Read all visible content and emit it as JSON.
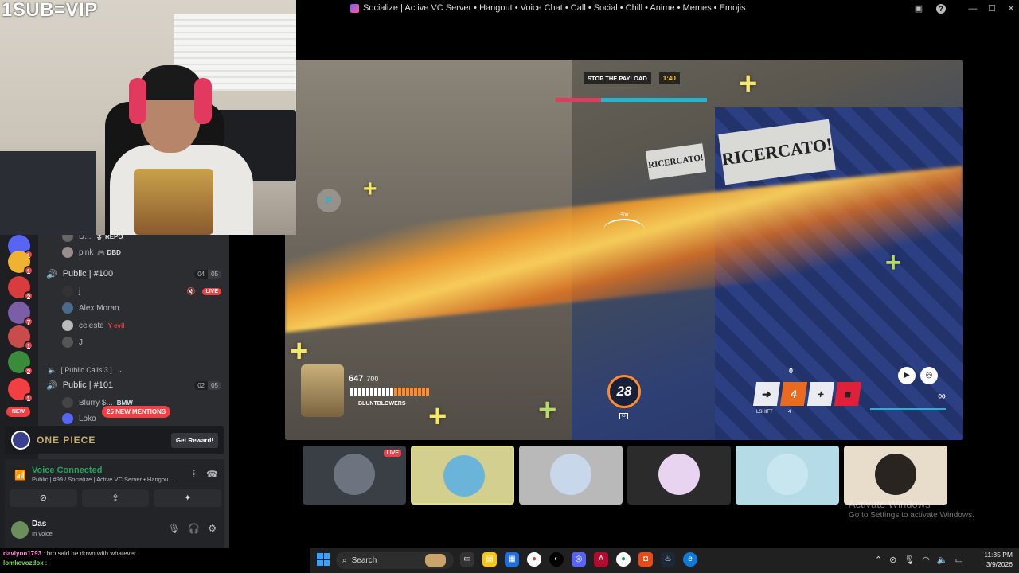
{
  "overlay": {
    "text": "1SUB=VIP"
  },
  "window": {
    "title": "Socialize | Active VC Server • Hangout • Voice Chat • Call • Social • Chill • Anime • Memes • Emojis"
  },
  "guilds": [
    {
      "name": "server-1",
      "badge": "1",
      "color": "#5865f2"
    },
    {
      "name": "discord-yellow",
      "badge": "1",
      "color": "#f0b232"
    },
    {
      "name": "server-3",
      "badge": "2",
      "color": "#d83c3e"
    },
    {
      "name": "server-4",
      "badge": "7",
      "color": "#7b5ea7"
    },
    {
      "name": "server-5",
      "badge": "1",
      "color": "#c94c4c"
    },
    {
      "name": "server-6",
      "badge": "2",
      "color": "#3a8c3a"
    },
    {
      "name": "discord-red",
      "badge": "1",
      "color": "#f23f43"
    }
  ],
  "new_label": "NEW",
  "channels": {
    "users_top": [
      {
        "name": "D...",
        "tag": "🎖 REPO"
      },
      {
        "name": "pink",
        "tag": "🎮 DBD"
      }
    ],
    "public100": {
      "name": "Public | #100",
      "count_a": "04",
      "count_b": "05"
    },
    "users_100": [
      {
        "name": "j",
        "live": "LIVE"
      },
      {
        "name": "Alex Moran",
        "tag": ""
      },
      {
        "name": "celeste",
        "tag": "Y evil"
      },
      {
        "name": "J",
        "tag": ""
      }
    ],
    "category": "[ Public Calls 3 ]",
    "public101": {
      "name": "Public | #101",
      "count_a": "02",
      "count_b": "05"
    },
    "users_101": [
      {
        "name": "Blurry $...",
        "tag": "BMW"
      },
      {
        "name": "Loko",
        "tag": ""
      }
    ],
    "mentions": "25 NEW MENTIONS"
  },
  "promo": {
    "brand": "ONE PIECE",
    "button": "Get Reward!"
  },
  "voice_panel": {
    "status": "Voice Connected",
    "channel": "Public | #99 / Socialize | Active VC Server • Hangou..."
  },
  "user": {
    "name": "Das",
    "status": "In voice"
  },
  "game": {
    "objective": "STOP THE PAYLOAD",
    "timer": "1:40",
    "payload_progress_fraction": 0.3,
    "sign_big": "RICERCATO!",
    "sign_small": "RICERCATO!",
    "crosshair_label": "1500",
    "hp": "647",
    "hp_max": "700",
    "player": "BLUNTBLOWERS",
    "ammo": "28",
    "ammo_key": "G",
    "ult_counter": "0",
    "ability_counter": "4",
    "ability_4_value": "4",
    "shift_label": "LSHIFT",
    "marker": "P"
  },
  "tiles": [
    {
      "name": "tile-stream",
      "live": "LIVE",
      "bg": "#3a3e45",
      "av": "#6d7480"
    },
    {
      "name": "tile-aang",
      "bg": "#d3cf8e",
      "av": "#6bb4d9"
    },
    {
      "name": "tile-cat",
      "bg": "#b9b9b9",
      "av": "#c8d7ea"
    },
    {
      "name": "tile-goth",
      "bg": "#2b2b2b",
      "av": "#e8d4f0"
    },
    {
      "name": "tile-lightblue",
      "bg": "#b5dbe7",
      "av": "#c8e6ef"
    },
    {
      "name": "tile-girl",
      "bg": "#e8dccb",
      "av": "#2a2420"
    }
  ],
  "watermark": {
    "line1": "Activate Windows",
    "line2": "Go to Settings to activate Windows."
  },
  "chat": [
    {
      "user": "daviyon1793",
      "message": ": bro said he down with whatever"
    },
    {
      "user": "lomkevozdox",
      "message": ":"
    }
  ],
  "taskbar": {
    "search": "Search",
    "time": "11:35 PM",
    "date": "3/9/2026"
  }
}
